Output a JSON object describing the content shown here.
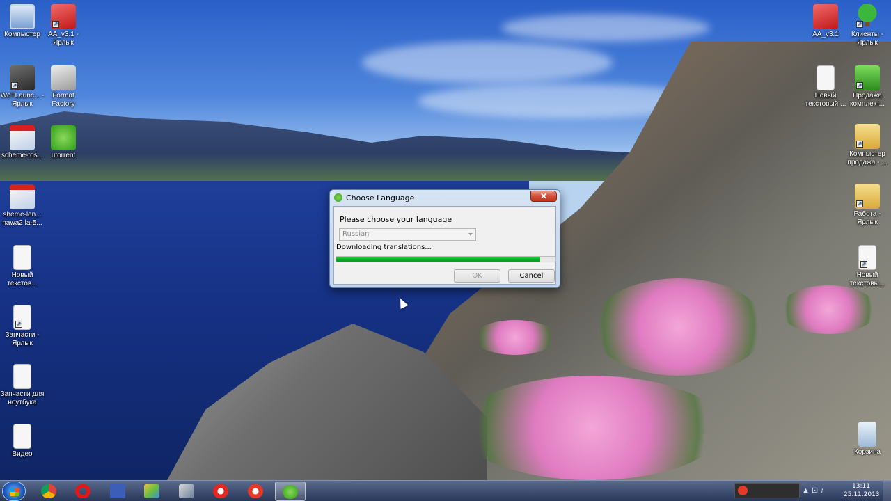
{
  "desktop": {
    "icons_left": [
      {
        "label": "Компьютер",
        "icon": "computer-icon"
      },
      {
        "label": "AA_v3.1 - Ярлык",
        "icon": "aa-icon"
      },
      {
        "label": "WoTLaunc... - Ярлык",
        "icon": "wot-icon"
      },
      {
        "label": "Format Factory",
        "icon": "format-factory-icon"
      },
      {
        "label": "scheme-tos...",
        "icon": "pdf-icon"
      },
      {
        "label": "utorrent",
        "icon": "utorrent-icon"
      },
      {
        "label": "sheme-len... nawa2 la-5...",
        "icon": "pdf-icon"
      },
      {
        "label": "Новый текстов...",
        "icon": "text-file-icon"
      },
      {
        "label": "Запчасти - Ярлык",
        "icon": "text-file-icon"
      },
      {
        "label": "Запчасти для ноутбука",
        "icon": "text-file-icon"
      },
      {
        "label": "Видео",
        "icon": "text-file-icon"
      }
    ],
    "icons_right": [
      {
        "label": "AA_v3.1",
        "icon": "aa-icon"
      },
      {
        "label": "Клиенты - Ярлык",
        "icon": "tree-icon"
      },
      {
        "label": "Новый текстовый ...",
        "icon": "text-file-icon"
      },
      {
        "label": "Продажа комплект...",
        "icon": "battery-icon"
      },
      {
        "label": "Компьютер продажа - ...",
        "icon": "folder-icon"
      },
      {
        "label": "Работа - Ярлык",
        "icon": "folder-icon"
      },
      {
        "label": "Новый текстовы...",
        "icon": "text-file-icon"
      },
      {
        "label": "Корзина",
        "icon": "recycle-bin-icon"
      }
    ]
  },
  "dialog": {
    "title": "Choose Language",
    "close_glyph": "✕",
    "prompt": "Please choose your language",
    "language_selected": "Russian",
    "status": "Downloading translations...",
    "progress": 0.93,
    "ok_label": "OK",
    "cancel_label": "Cancel"
  },
  "taskbar": {
    "buttons": [
      "chrome-icon",
      "opera-icon",
      "save-icon",
      "paint-icon",
      "control-panel-icon",
      "yandex-icon",
      "record-icon",
      "utorrent-icon"
    ],
    "active": "utorrent-icon",
    "time": "13:11",
    "date": "25.11.2013",
    "tray_glyphs": "▲ ⊡ ♪"
  },
  "colors": {
    "progress_green": "#06b025",
    "close_red": "#c1361b",
    "taskbar": "#1e2d50"
  }
}
